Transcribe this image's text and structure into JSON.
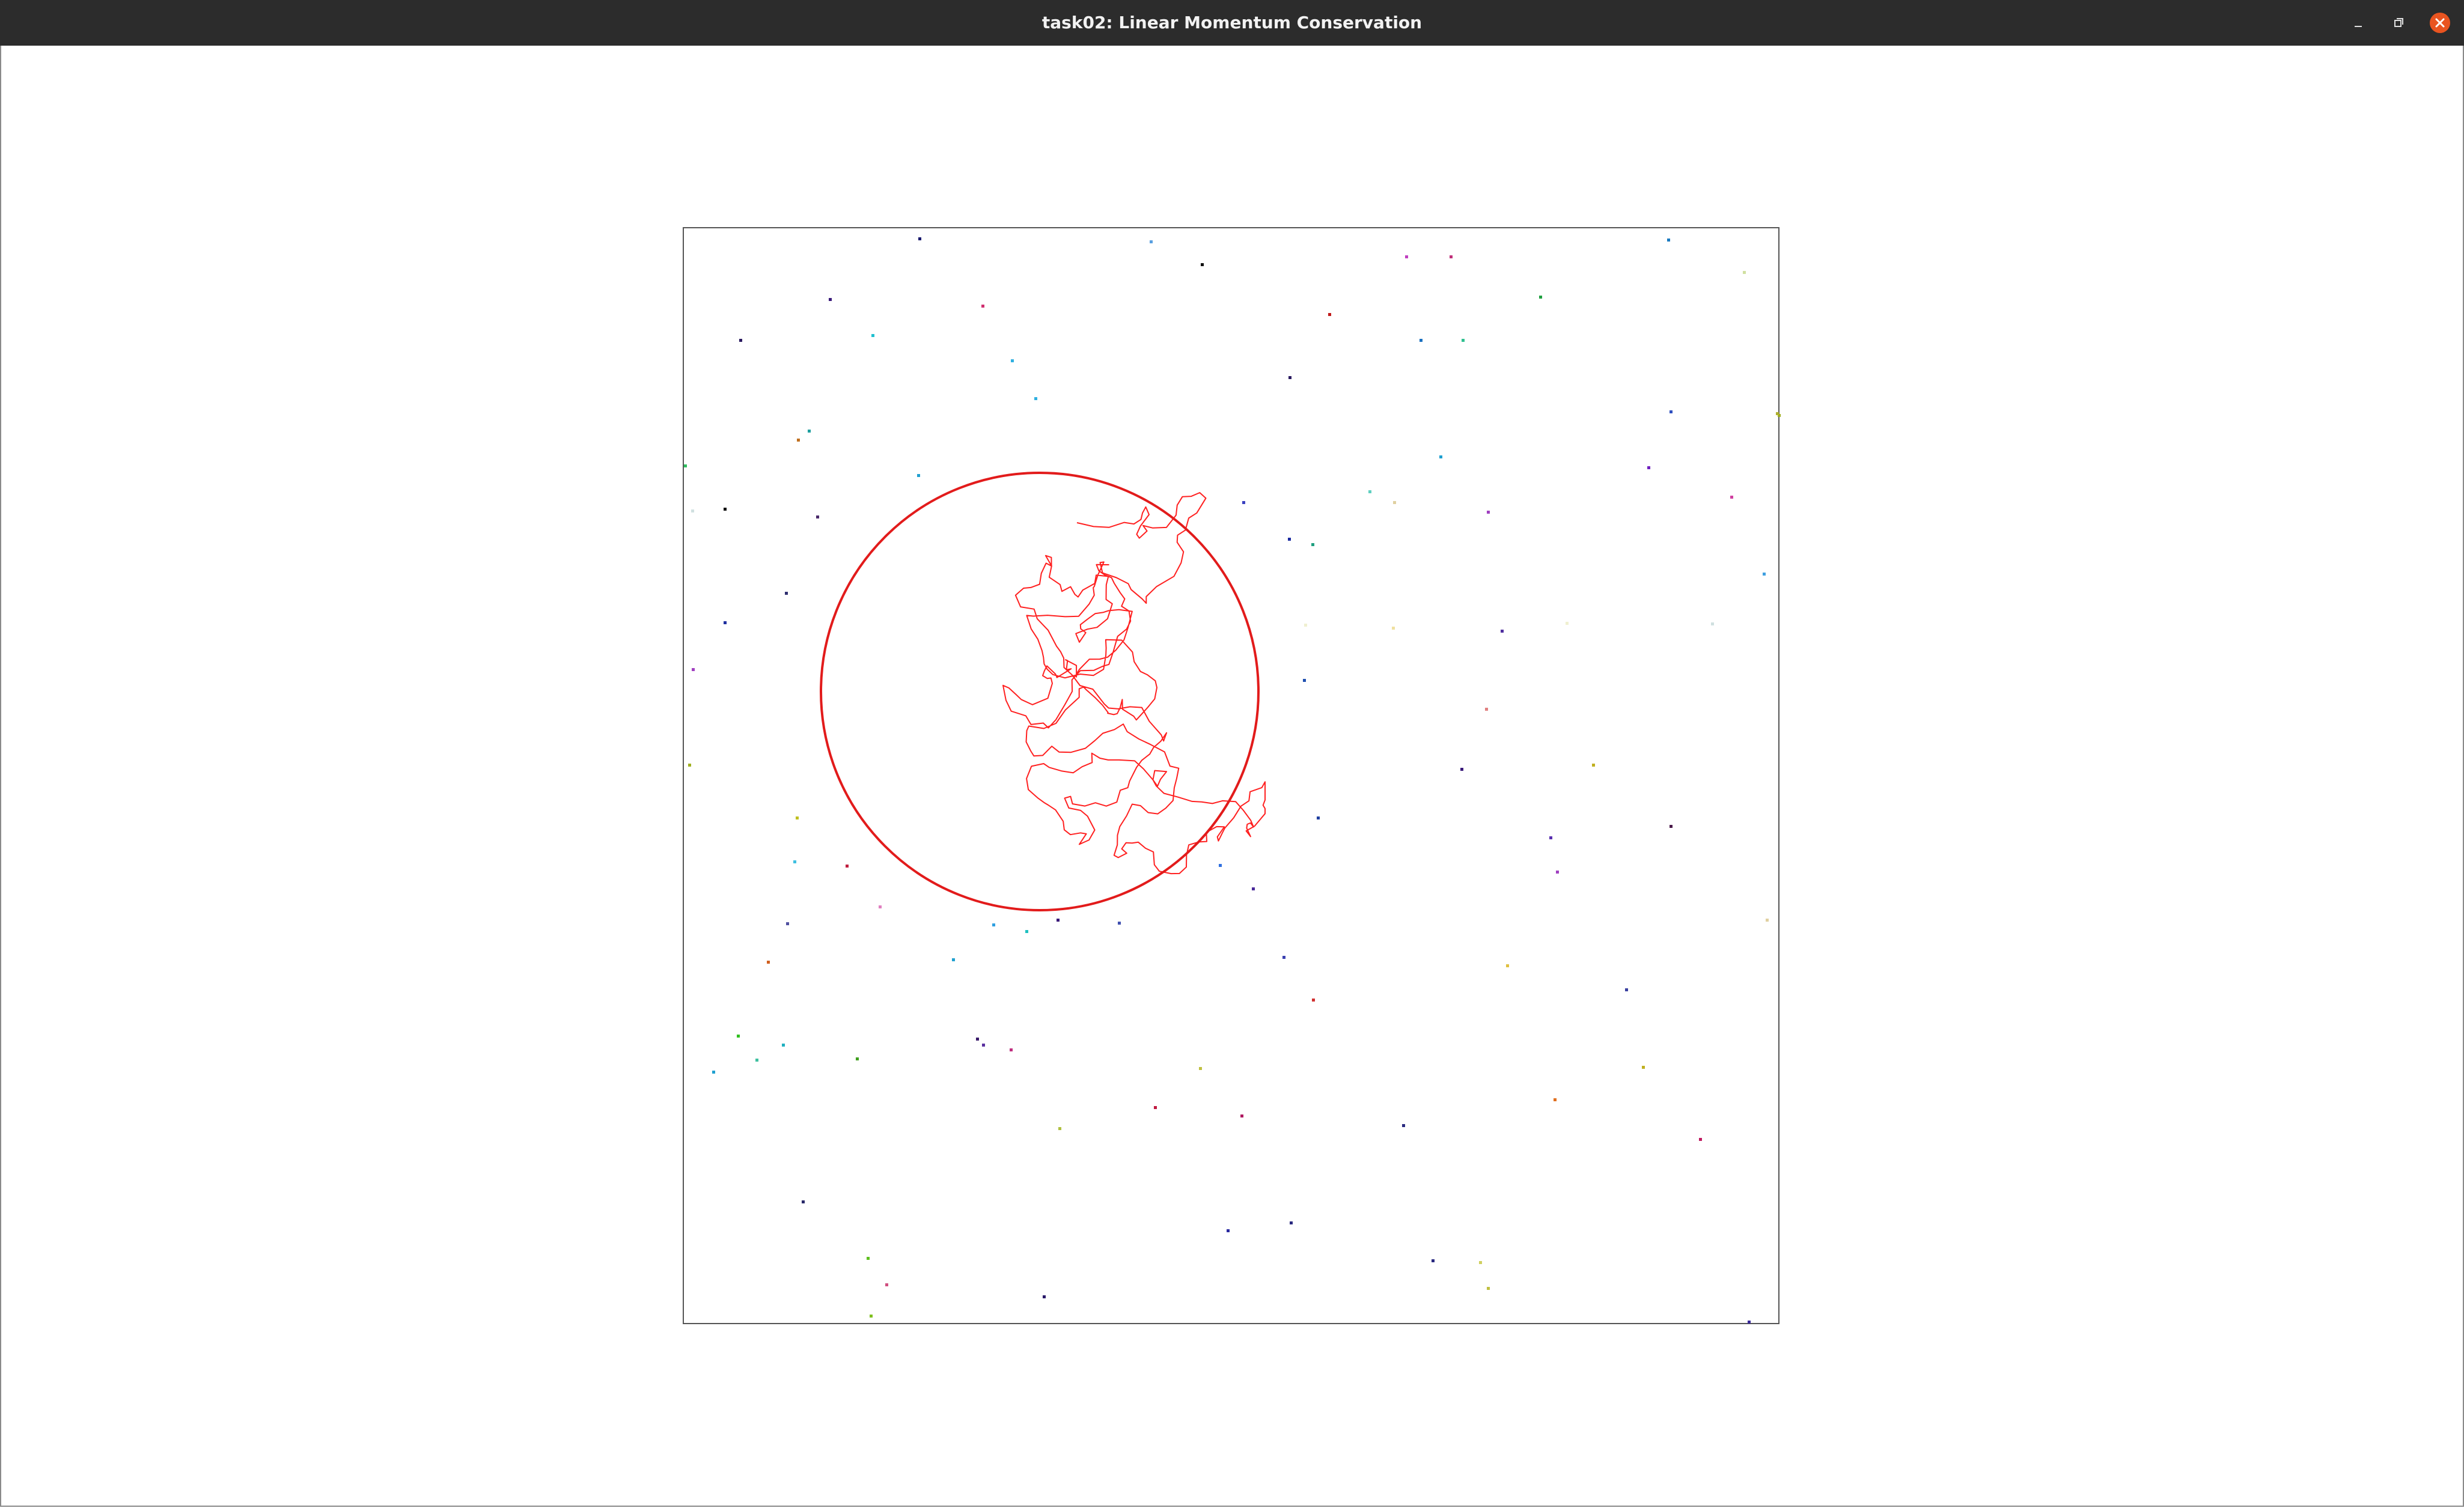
{
  "window": {
    "title": "task02: Linear Momentum Conservation",
    "controls": [
      {
        "name": "minimize-button",
        "icon": "minimize-icon"
      },
      {
        "name": "maximize-button",
        "icon": "restore-icon"
      },
      {
        "name": "close-button",
        "icon": "close-icon"
      }
    ]
  },
  "colors": {
    "titlebar": "#2c2c2c",
    "close_button": "#e95420",
    "trajectory": "#ff2020",
    "big_ball": "#e21b1b",
    "box_border": "#555555"
  }
}
